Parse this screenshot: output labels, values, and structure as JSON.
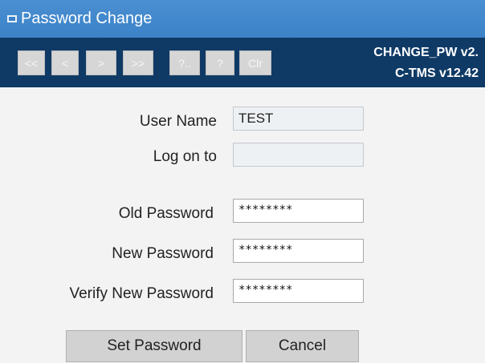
{
  "window": {
    "title": "Password Change"
  },
  "toolbar": {
    "buttons": [
      "<<",
      "<",
      ">",
      ">>",
      "?..",
      "?",
      "Clr"
    ],
    "version_line1": "CHANGE_PW v2.",
    "version_line2": "C-TMS v12.42"
  },
  "form": {
    "user_name_label": "User Name",
    "user_name_value": "TEST",
    "log_on_to_label": "Log on to",
    "log_on_to_value": "",
    "old_password_label": "Old Password",
    "old_password_value": "********",
    "new_password_label": "New Password",
    "new_password_value": "********",
    "verify_password_label": "Verify New Password",
    "verify_password_value": "********"
  },
  "actions": {
    "set_password_label": "Set Password",
    "cancel_label": "Cancel"
  }
}
